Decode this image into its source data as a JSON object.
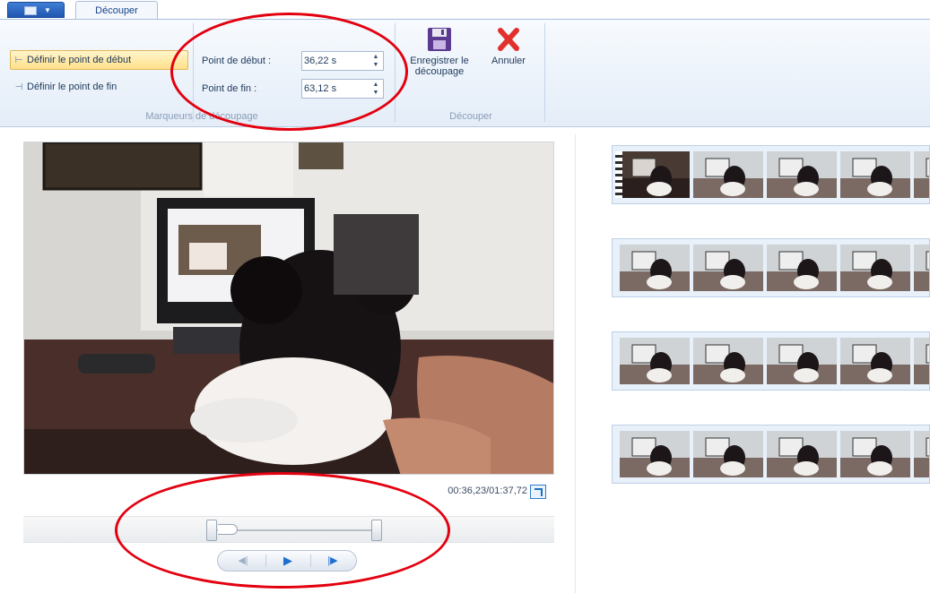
{
  "tabs": [
    {
      "label": "Découper"
    }
  ],
  "ribbon": {
    "groups": [
      {
        "label": "Marqueurs de découpage"
      },
      {
        "label": "Découper"
      }
    ],
    "set_start_label": "Définir le point de début",
    "set_end_label": "Définir le point de fin",
    "start_point": {
      "label": "Point de début :",
      "value": "36,22 s"
    },
    "end_point": {
      "label": "Point de fin :",
      "value": "63,12 s"
    },
    "save_trim_label": "Enregistrer le découpage",
    "cancel_label": "Annuler"
  },
  "player": {
    "timecode": "00:36,23/01:37,72"
  },
  "storyboard": {
    "rows": 4,
    "frames_per_row": 5
  },
  "colors": {
    "annotation": "#e3000f",
    "accent": "#1e6fd1",
    "ribbon_bg": "#e4edf8",
    "active_button": "#ffe08a"
  },
  "icons": [
    "app-menu-icon",
    "marker-start-icon",
    "marker-end-icon",
    "save-disk-icon",
    "cancel-x-icon",
    "expand-icon",
    "previous-frame-icon",
    "play-icon",
    "next-frame-icon"
  ]
}
